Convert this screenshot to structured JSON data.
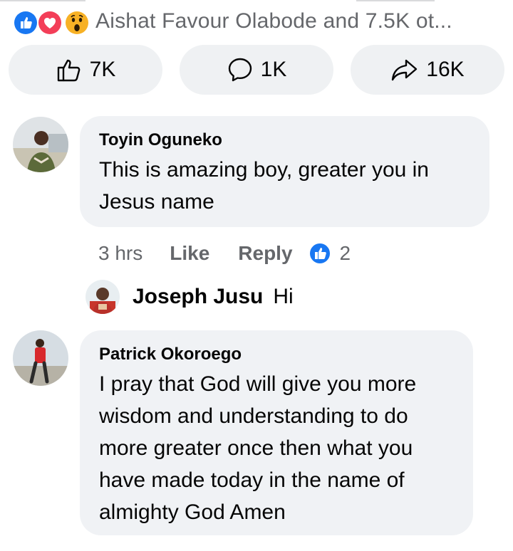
{
  "summary": {
    "reaction_icons": [
      "like-icon",
      "love-icon",
      "wow-icon"
    ],
    "reactors_text": "Aishat Favour Olabode and 7.5K ot..."
  },
  "actions": {
    "like_count": "7K",
    "comment_count": "1K",
    "share_count": "16K"
  },
  "comments": [
    {
      "author": "Toyin Oguneko",
      "text_lines": [
        "This is amazing boy, greater you in",
        "Jesus name"
      ],
      "time": "3 hrs",
      "like_label": "Like",
      "reply_label": "Reply",
      "reaction_count": "2",
      "reply": {
        "author": "Joseph Jusu",
        "text": "Hi"
      }
    },
    {
      "author": "Patrick Okoroego",
      "text_lines": [
        "I pray that God will give you more",
        "wisdom and understanding to do",
        "more greater once then what you",
        "have made today in the name of",
        "almighty God Amen"
      ]
    }
  ],
  "colors": {
    "like_blue": "#1877f2",
    "love_red": "#f33e58",
    "wow_yellow": "#f7b125",
    "bubble_bg": "#f0f2f5",
    "pill_bg": "#eff1f3",
    "secondary_text": "#65676b"
  }
}
